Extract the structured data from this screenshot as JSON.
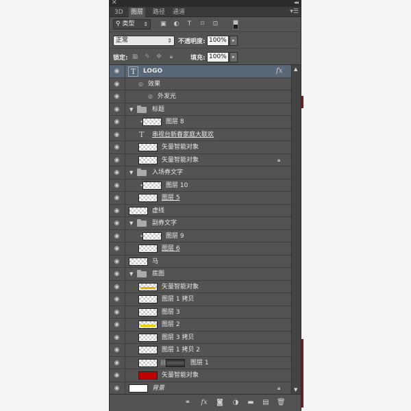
{
  "tabs": [
    {
      "label": "3D",
      "active": false
    },
    {
      "label": "图层",
      "active": true
    },
    {
      "label": "路径",
      "active": false
    },
    {
      "label": "通道",
      "active": false
    }
  ],
  "filter": {
    "kind_label": "类型"
  },
  "blend": {
    "mode": "正常",
    "opacity_label": "不透明度:",
    "opacity_value": "100%"
  },
  "lock": {
    "label": "锁定:",
    "fill_label": "填充:",
    "fill_value": "100%"
  },
  "layers": [
    {
      "type": "text",
      "name": "LOGO",
      "selected": true,
      "fx": true
    },
    {
      "type": "effects",
      "name": "效果"
    },
    {
      "type": "effect",
      "name": "外发光"
    },
    {
      "type": "group",
      "name": "标题",
      "depth": 0,
      "open": true
    },
    {
      "type": "layer",
      "name": "图层 8",
      "depth": 1,
      "clip": true
    },
    {
      "type": "text",
      "name": "串视台新春家庭大联欢",
      "depth": 1,
      "underline": true
    },
    {
      "type": "smart",
      "name": "矢量智能对象",
      "depth": 1
    },
    {
      "type": "smart",
      "name": "矢量智能对象",
      "depth": 1,
      "locked": true
    },
    {
      "type": "group",
      "name": "入场券文字",
      "depth": 0,
      "open": true
    },
    {
      "type": "layer",
      "name": "图层 10",
      "depth": 1,
      "clip": true
    },
    {
      "type": "layer",
      "name": "图层 5",
      "depth": 1,
      "underline": true
    },
    {
      "type": "layer",
      "name": "虚线",
      "depth": 0
    },
    {
      "type": "group",
      "name": "副券文字",
      "depth": 0,
      "open": true
    },
    {
      "type": "layer",
      "name": "图层 9",
      "depth": 1,
      "clip": true
    },
    {
      "type": "layer",
      "name": "图层 6",
      "depth": 1,
      "underline": true
    },
    {
      "type": "layer",
      "name": "马",
      "depth": 0
    },
    {
      "type": "group",
      "name": "底图",
      "depth": 0,
      "open": true
    },
    {
      "type": "smart",
      "name": "矢量智能对象",
      "depth": 1,
      "stripe": "#e8b000"
    },
    {
      "type": "layer",
      "name": "图层 1 拷贝",
      "depth": 1
    },
    {
      "type": "layer",
      "name": "图层 3",
      "depth": 1
    },
    {
      "type": "layer",
      "name": "图层 2",
      "depth": 1,
      "stripe": "#e8d000"
    },
    {
      "type": "layer",
      "name": "图层 3 拷贝",
      "depth": 1
    },
    {
      "type": "layer",
      "name": "图层 1 拷贝 2",
      "depth": 1
    },
    {
      "type": "masked",
      "name": "图层 1",
      "depth": 1
    },
    {
      "type": "smart",
      "name": "矢量智能对象",
      "depth": 1,
      "thumb": "red"
    },
    {
      "type": "background",
      "name": "背景",
      "depth": 0,
      "locked": true
    }
  ],
  "bottom_icons": [
    "link-icon",
    "fx-icon",
    "mask-icon",
    "adjustment-icon",
    "folder-icon",
    "new-layer-icon",
    "trash-icon"
  ]
}
